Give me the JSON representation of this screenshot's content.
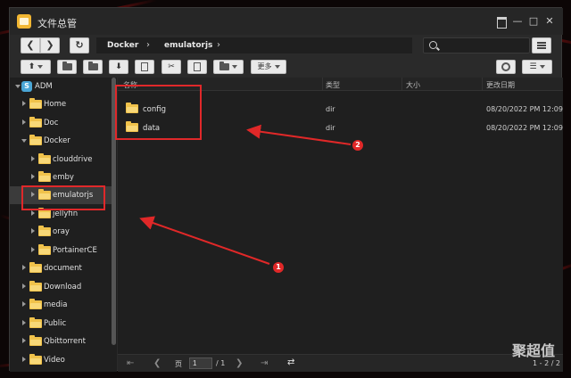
{
  "window": {
    "title": "文件总管"
  },
  "path": {
    "crumbs": [
      "Docker",
      "emulatorjs"
    ]
  },
  "search": {
    "placeholder": ""
  },
  "toolbar": {
    "more_label": "更多"
  },
  "sidebar": {
    "root": "ADM",
    "items": [
      {
        "label": "Home"
      },
      {
        "label": "Doc"
      },
      {
        "label": "Docker"
      },
      {
        "label": "clouddrive"
      },
      {
        "label": "emby"
      },
      {
        "label": "emulatorjs"
      },
      {
        "label": "jellyfin"
      },
      {
        "label": "oray"
      },
      {
        "label": "PortainerCE"
      },
      {
        "label": "document"
      },
      {
        "label": "Download"
      },
      {
        "label": "media"
      },
      {
        "label": "Public"
      },
      {
        "label": "Qbittorrent"
      },
      {
        "label": "Video"
      }
    ]
  },
  "file_list": {
    "columns": [
      "名称",
      "类型",
      "大小",
      "更改日期"
    ],
    "rows": [
      {
        "name": "config",
        "type": "dir",
        "size": "",
        "modified": "08/20/2022 PM 12:09"
      },
      {
        "name": "data",
        "type": "dir",
        "size": "",
        "modified": "08/20/2022 PM 12:09"
      }
    ]
  },
  "pager": {
    "page_prefix": "页",
    "page_value": "1",
    "page_total": "/ 1",
    "count": "1 - 2 / 2"
  },
  "annotations": {
    "marker_1": "1",
    "marker_2": "2"
  },
  "watermark": {
    "text": "聚超值"
  },
  "colors": {
    "accent_red": "#e02828",
    "folder": "#f0c24b",
    "panel": "#1f1f1f"
  }
}
